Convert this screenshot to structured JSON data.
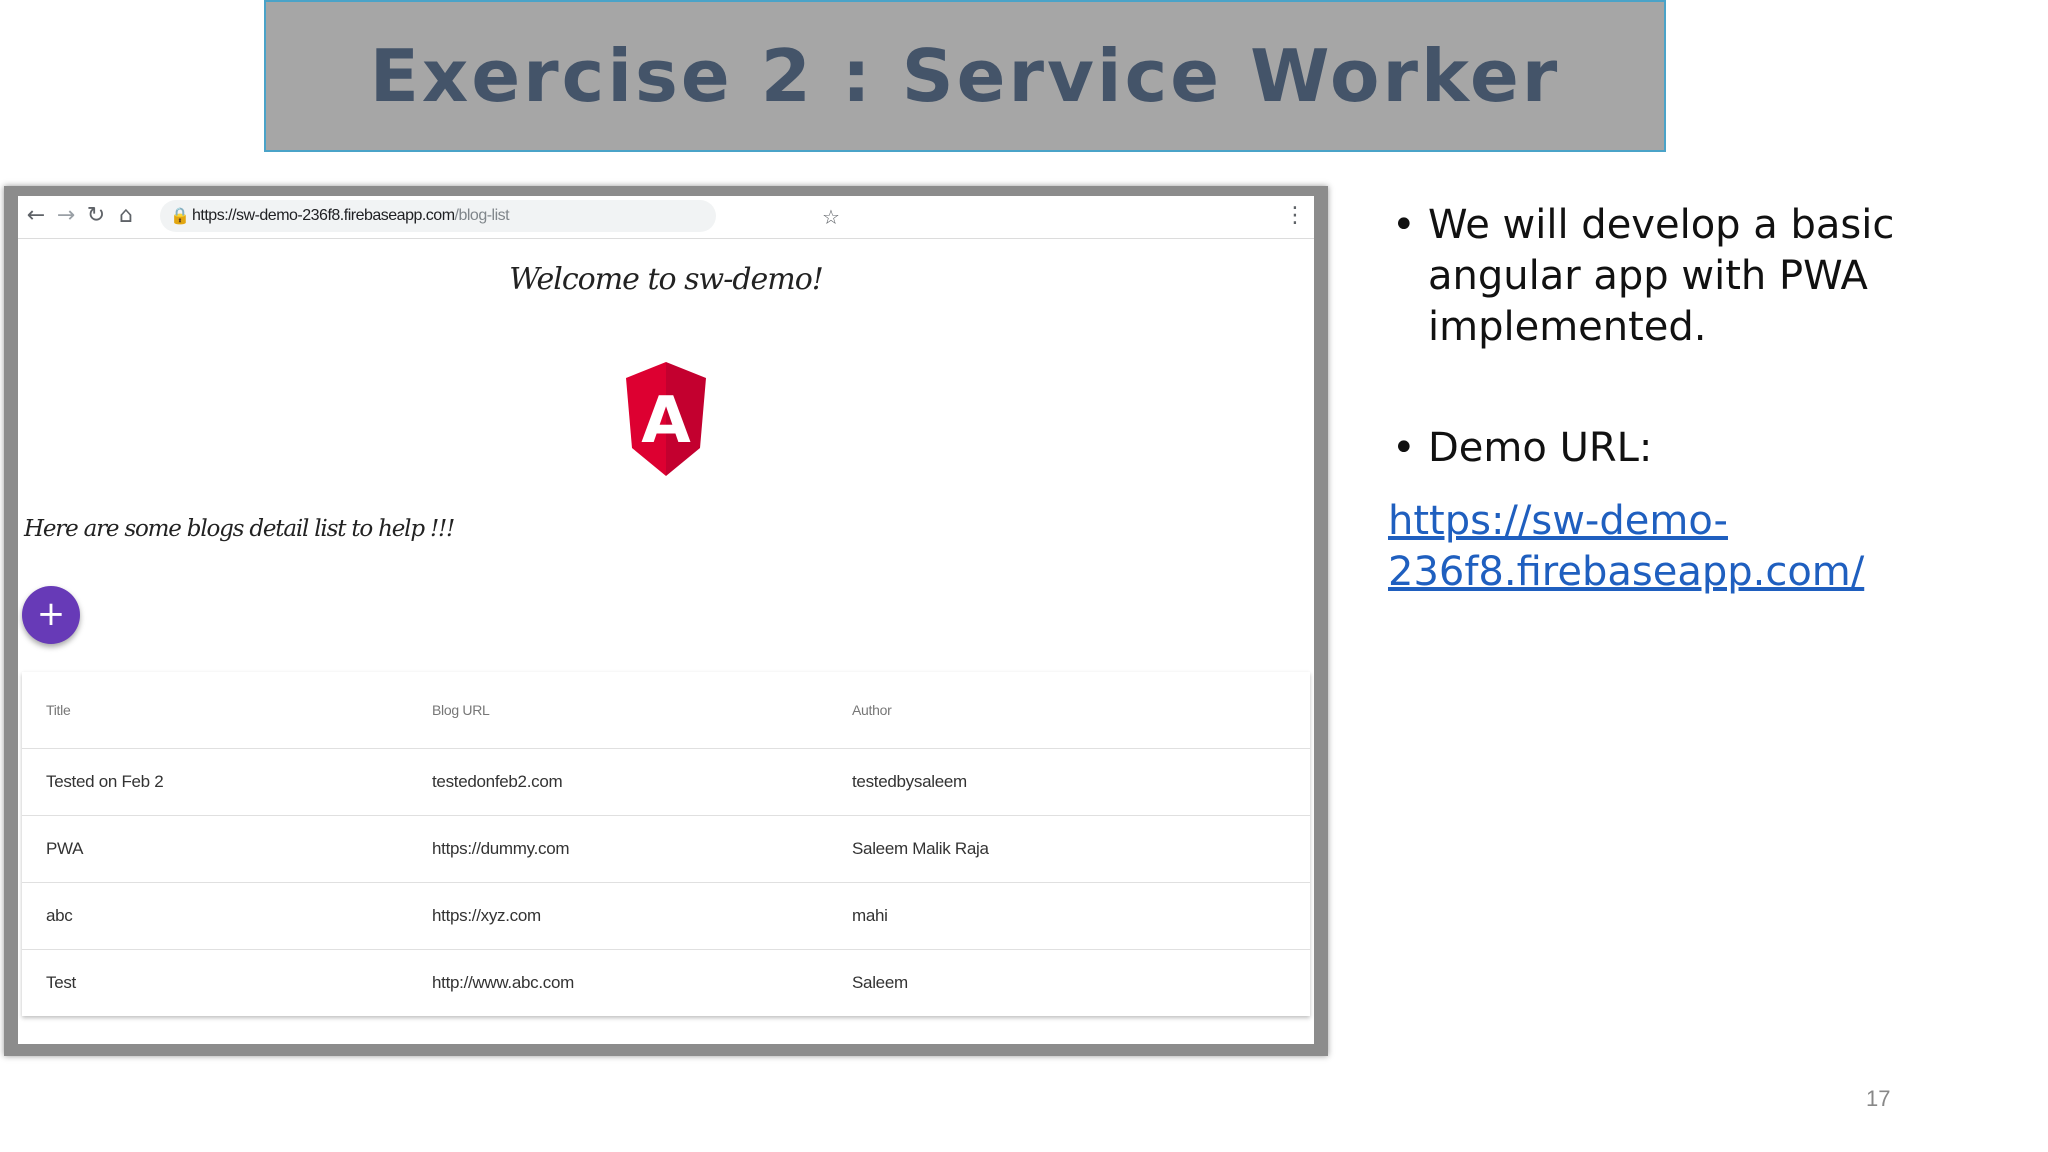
{
  "slide": {
    "title": "Exercise 2 : Service Worker",
    "page_number": "17",
    "bullets": [
      "We will develop a basic angular app with PWA implemented.",
      "Demo URL:"
    ],
    "demo_link": "https://sw-demo-236f8.firebaseapp.com/"
  },
  "browser": {
    "url_host": "https://sw-demo-236f8.firebaseapp.com",
    "url_path": "/blog-list",
    "icons": {
      "back": "back-arrow-icon",
      "forward": "forward-arrow-icon",
      "reload": "reload-icon",
      "home": "home-icon",
      "lock": "lock-icon",
      "bookmark": "star-icon",
      "menu": "kebab-menu-icon"
    }
  },
  "app": {
    "welcome": "Welcome to sw-demo!",
    "logo_letter": "A",
    "intro": "Here are some blogs detail list to help !!!",
    "fab_label": "+",
    "colors": {
      "fab": "#673ab7",
      "logo_red": "#dd0031",
      "logo_dark": "#c3002f"
    },
    "table": {
      "headers": [
        "Title",
        "Blog URL",
        "Author"
      ],
      "rows": [
        [
          "Tested on Feb 2",
          "testedonfeb2.com",
          "testedbysaleem"
        ],
        [
          "PWA",
          "https://dummy.com",
          "Saleem Malik Raja"
        ],
        [
          "abc",
          "https://xyz.com",
          "mahi"
        ],
        [
          "Test",
          "http://www.abc.com",
          "Saleem"
        ]
      ]
    }
  }
}
